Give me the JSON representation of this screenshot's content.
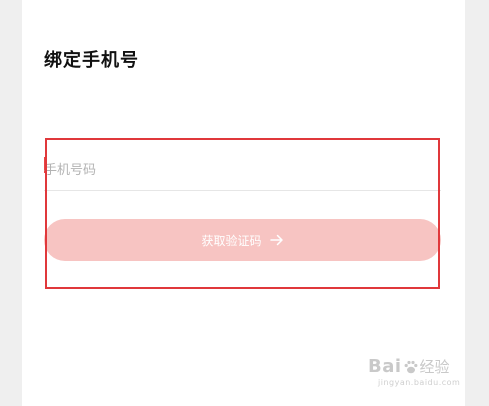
{
  "page": {
    "title": "绑定手机号"
  },
  "phone": {
    "placeholder": "手机号码",
    "value": ""
  },
  "cta": {
    "label": "获取验证码",
    "icon": "arrow-right-icon"
  },
  "colors": {
    "accent_disabled": "#f7c4c2",
    "highlight": "#e0383b",
    "background": "#efefef"
  },
  "watermark": {
    "brand": "Bai",
    "name": "经验",
    "url": "jingyan.baidu.com"
  }
}
